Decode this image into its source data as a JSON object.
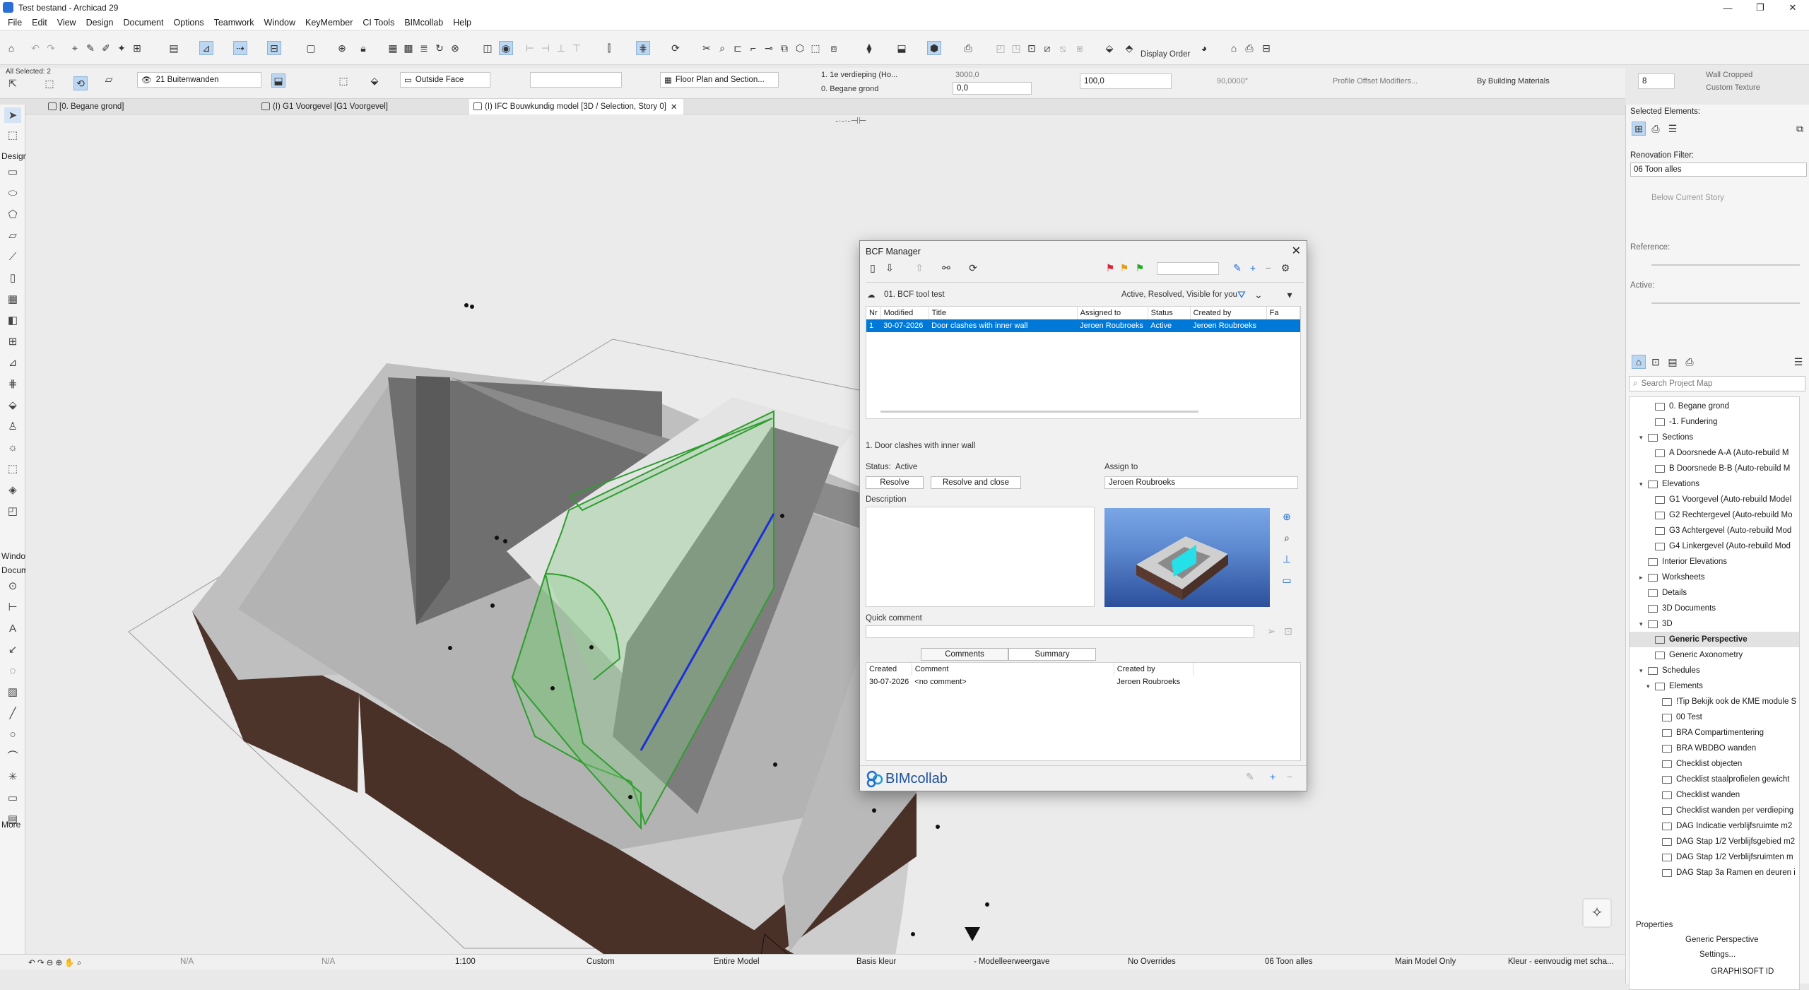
{
  "window": {
    "title": "Test bestand - Archicad 29",
    "min": "—",
    "max": "❐",
    "close": "✕"
  },
  "menu": [
    "File",
    "Edit",
    "View",
    "Design",
    "Document",
    "Options",
    "Teamwork",
    "Window",
    "KeyMember",
    "CI Tools",
    "BIMcollab",
    "Help"
  ],
  "toolbar": {
    "display_order": "Display Order"
  },
  "infobox": {
    "selected": "All Selected: 2",
    "layer": "21 Buitenwanden",
    "face": "Outside Face",
    "view": "Floor Plan and Section...",
    "story_top": "1. 1e verdieping (Ho...",
    "story_bottom": "0. Begane grond",
    "height_top": "3000,0",
    "height_bottom": "0,0",
    "thickness": "100,0",
    "angle": "90,0000°",
    "profile": "Profile Offset Modifiers...",
    "materials": "By Building Materials",
    "count": "8",
    "wall_cropped": "Wall Cropped",
    "custom_texture": "Custom Texture"
  },
  "tabs": [
    {
      "label": "[0. Begane grond]"
    },
    {
      "label": "(I) G1 Voorgevel [G1 Voorgevel]"
    },
    {
      "label": "(I) IFC Bouwkundig model [3D / Selection, Story 0]"
    }
  ],
  "left_toolbox": {
    "design": "Design",
    "window": "Windo",
    "document": "Docum",
    "more": "More"
  },
  "statusbar": {
    "na1": "N/A",
    "na2": "N/A",
    "scale": "1:100",
    "custom": "Custom",
    "model": "Entire Model",
    "pen": "Basis kleur",
    "view": "- Modelleerweergave",
    "overrides": "No Overrides",
    "renovation": "06 Toon alles",
    "main": "Main Model Only",
    "colour": "Kleur - eenvoudig met scha..."
  },
  "right_panel": {
    "selected_elements": "Selected Elements:",
    "renovation_filter": "Renovation Filter:",
    "renovation_value": "06 Toon alles",
    "below_story": "Below Current Story",
    "reference": "Reference:",
    "active": "Active:",
    "search_placeholder": "Search Project Map",
    "properties": "Properties",
    "prop_value": "Generic Perspective",
    "settings": "Settings...",
    "graphisoft": "GRAPHISOFT ID"
  },
  "project_map": [
    {
      "label": "0. Begane grond",
      "level": 2,
      "arrow": ""
    },
    {
      "label": "-1. Fundering",
      "level": 2,
      "arrow": ""
    },
    {
      "label": "Sections",
      "level": 1,
      "arrow": "▾"
    },
    {
      "label": "A Doorsnede A-A (Auto-rebuild M",
      "level": 2,
      "arrow": ""
    },
    {
      "label": "B Doorsnede B-B (Auto-rebuild M",
      "level": 2,
      "arrow": ""
    },
    {
      "label": "Elevations",
      "level": 1,
      "arrow": "▾"
    },
    {
      "label": "G1 Voorgevel (Auto-rebuild Model",
      "level": 2,
      "arrow": ""
    },
    {
      "label": "G2 Rechtergevel (Auto-rebuild Mo",
      "level": 2,
      "arrow": ""
    },
    {
      "label": "G3 Achtergevel (Auto-rebuild Mod",
      "level": 2,
      "arrow": ""
    },
    {
      "label": "G4 Linkergevel (Auto-rebuild Mod",
      "level": 2,
      "arrow": ""
    },
    {
      "label": "Interior Elevations",
      "level": 1,
      "arrow": ""
    },
    {
      "label": "Worksheets",
      "level": 1,
      "arrow": "▸"
    },
    {
      "label": "Details",
      "level": 1,
      "arrow": ""
    },
    {
      "label": "3D Documents",
      "level": 1,
      "arrow": ""
    },
    {
      "label": "3D",
      "level": 1,
      "arrow": "▾"
    },
    {
      "label": "Generic Perspective",
      "level": 2,
      "arrow": "",
      "selected": true
    },
    {
      "label": "Generic Axonometry",
      "level": 2,
      "arrow": ""
    },
    {
      "label": "Schedules",
      "level": 1,
      "arrow": "▾"
    },
    {
      "label": "Elements",
      "level": 2,
      "arrow": "▾"
    },
    {
      "label": "!Tip Bekijk ook de KME module S",
      "level": 3,
      "arrow": ""
    },
    {
      "label": "00 Test",
      "level": 3,
      "arrow": ""
    },
    {
      "label": "BRA Compartimentering",
      "level": 3,
      "arrow": ""
    },
    {
      "label": "BRA WBDBO wanden",
      "level": 3,
      "arrow": ""
    },
    {
      "label": "Checklist objecten",
      "level": 3,
      "arrow": ""
    },
    {
      "label": "Checklist staalprofielen gewicht",
      "level": 3,
      "arrow": ""
    },
    {
      "label": "Checklist wanden",
      "level": 3,
      "arrow": ""
    },
    {
      "label": "Checklist wanden per verdieping",
      "level": 3,
      "arrow": ""
    },
    {
      "label": "DAG Indicatie verblijfsruimte m2",
      "level": 3,
      "arrow": ""
    },
    {
      "label": "DAG Stap 1/2 Verblijfsgebied m2",
      "level": 3,
      "arrow": ""
    },
    {
      "label": "DAG Stap 1/2 Verblijfsruimten m",
      "level": 3,
      "arrow": ""
    },
    {
      "label": "DAG Stap 3a Ramen en deuren i",
      "level": 3,
      "arrow": ""
    }
  ],
  "bcf": {
    "title": "BCF Manager",
    "project": "01. BCF tool test",
    "filter": "Active, Resolved, Visible for you",
    "columns": [
      "Nr",
      "Modified",
      "Title",
      "Assigned to",
      "Status",
      "Created by",
      "Fa"
    ],
    "issues": [
      {
        "nr": "1",
        "modified": "30-07-2026",
        "title": "Door clashes with inner wall",
        "assigned": "Jeroen Roubroeks",
        "status": "Active",
        "created_by": "Jeroen Roubroeks"
      }
    ],
    "selected_issue": "1. Door clashes with inner wall",
    "status_label": "Status:",
    "status_value": "Active",
    "resolve": "Resolve",
    "resolve_close": "Resolve and close",
    "assign_to": "Assign to",
    "assign_value": "Jeroen Roubroeks",
    "description": "Description",
    "quick_comment": "Quick comment",
    "tab_comments": "Comments",
    "tab_summary": "Summary",
    "comment_columns": [
      "Created",
      "Comment",
      "Created by"
    ],
    "comments": [
      {
        "created": "30-07-2026",
        "comment": "<no comment>",
        "by": "Jeroen Roubroeks"
      }
    ],
    "brand": "BIMcollab"
  },
  "colors": {
    "accent": "#0078d7",
    "selection_green": "#2e9e2e",
    "brick": "#4a3128"
  }
}
